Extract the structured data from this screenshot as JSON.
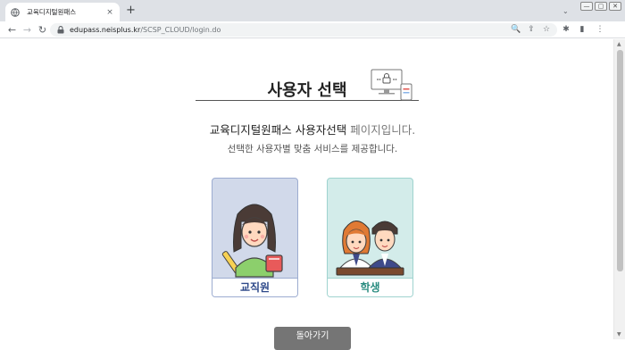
{
  "browser": {
    "tab_title": "교육디지털원패스",
    "tab_close_glyph": "×",
    "new_tab_glyph": "+",
    "tabstrip_menu_glyph": "⌄",
    "window_controls": [
      "—",
      "▢",
      "✕"
    ],
    "nav": {
      "back_glyph": "←",
      "forward_glyph": "→",
      "reload_glyph": "↻"
    },
    "url_host": "edupass.neisplus.kr",
    "url_path": "/SCSP_CLOUD/login.do",
    "omnibox_icons": {
      "search_glyph": "🔍",
      "share_glyph": "⇪",
      "bookmark_glyph": "☆"
    },
    "toolbar_icons": {
      "extensions_glyph": "✱",
      "sidepanel_glyph": "▮",
      "menu_glyph": "⋮"
    },
    "scroll_glyphs": {
      "up": "▲",
      "down": "▼"
    }
  },
  "page": {
    "title": "사용자 선택",
    "intro_strong": "교육디지털원패스 사용자선택",
    "intro_muted": "페이지입니다.",
    "intro_sub": "선택한 사용자별 맞춤 서비스를 제공합니다.",
    "cards": [
      {
        "label": "교직원",
        "icon": "teacher-illustration"
      },
      {
        "label": "학생",
        "icon": "students-illustration"
      }
    ],
    "back_button": "돌아가기"
  },
  "colors": {
    "staff_card_bg": "#d1d9ea",
    "student_card_bg": "#d3ecea",
    "staff_label": "#2f4a8a",
    "student_label": "#2a8c80",
    "back_button_bg": "#757575"
  }
}
